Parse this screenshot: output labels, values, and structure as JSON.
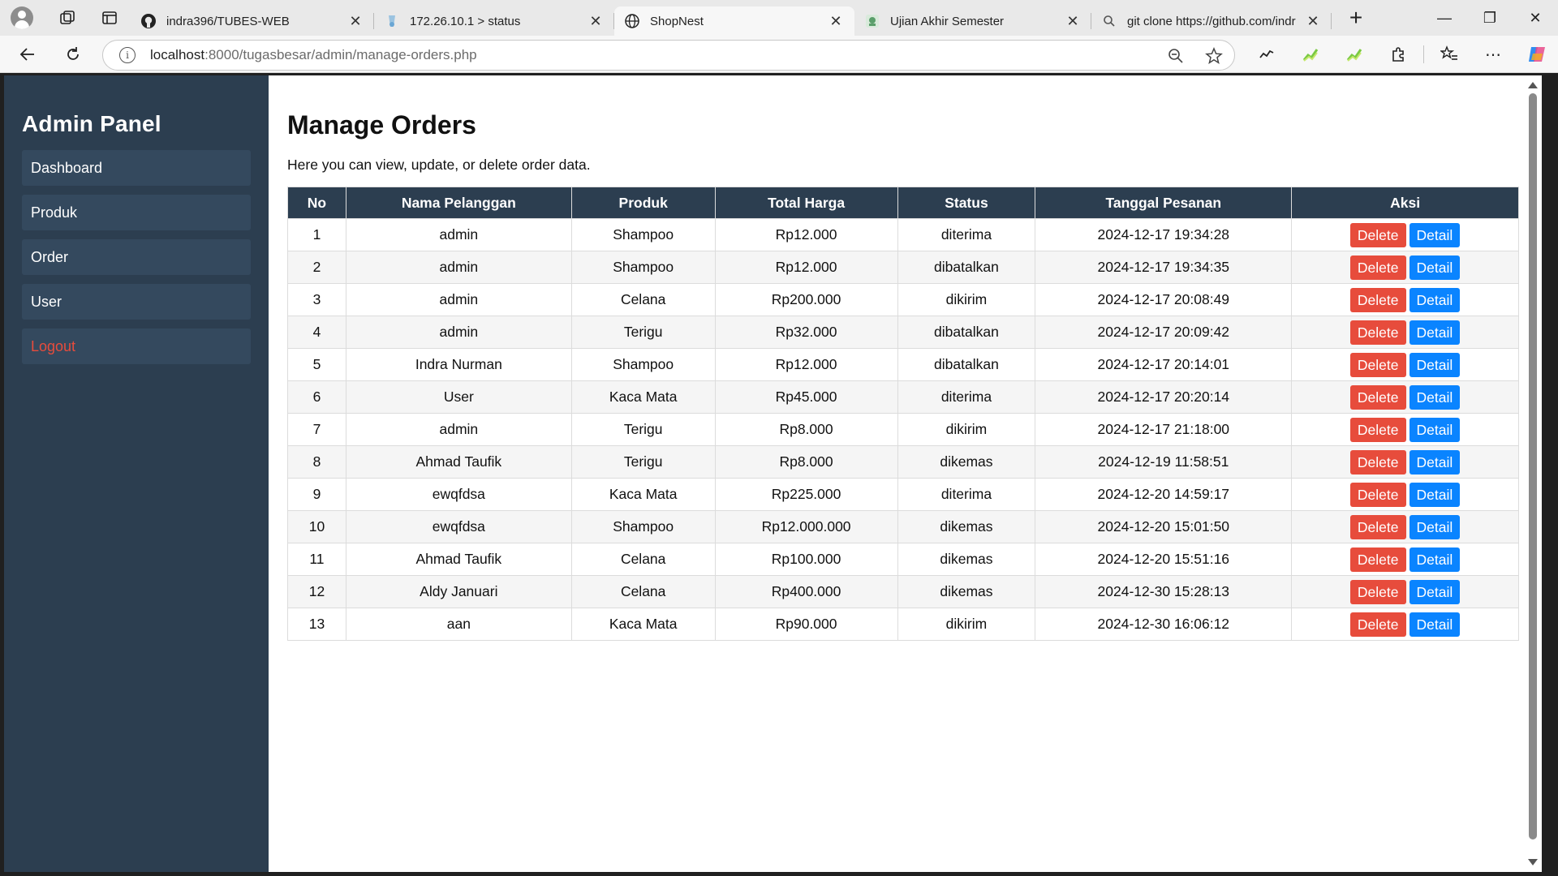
{
  "browser": {
    "tabs": [
      {
        "title": "indra396/TUBES-WEB",
        "icon": "github-icon",
        "active": false
      },
      {
        "title": "172.26.10.1 > status",
        "icon": "router-icon",
        "active": false
      },
      {
        "title": "ShopNest",
        "icon": "globe-icon",
        "active": true
      },
      {
        "title": "Ujian Akhir Semester",
        "icon": "moodle-icon",
        "active": false
      },
      {
        "title": "git clone https://github.com/indr",
        "icon": "search-icon",
        "active": false
      }
    ],
    "new_tab": "+",
    "url_host": "localhost",
    "url_rest": ":8000/tugasbesar/admin/manage-orders.php"
  },
  "sidebar": {
    "title": "Admin Panel",
    "items": [
      {
        "label": "Dashboard"
      },
      {
        "label": "Produk"
      },
      {
        "label": "Order"
      },
      {
        "label": "User"
      },
      {
        "label": "Logout"
      }
    ]
  },
  "main": {
    "title": "Manage Orders",
    "subtitle": "Here you can view, update, or delete order data.",
    "columns": [
      "No",
      "Nama Pelanggan",
      "Produk",
      "Total Harga",
      "Status",
      "Tanggal Pesanan",
      "Aksi"
    ],
    "delete_label": "Delete",
    "detail_label": "Detail",
    "orders": [
      {
        "no": "1",
        "customer": "admin",
        "product": "Shampoo",
        "total": "Rp12.000",
        "status": "diterima",
        "date": "2024-12-17 19:34:28"
      },
      {
        "no": "2",
        "customer": "admin",
        "product": "Shampoo",
        "total": "Rp12.000",
        "status": "dibatalkan",
        "date": "2024-12-17 19:34:35"
      },
      {
        "no": "3",
        "customer": "admin",
        "product": "Celana",
        "total": "Rp200.000",
        "status": "dikirim",
        "date": "2024-12-17 20:08:49"
      },
      {
        "no": "4",
        "customer": "admin",
        "product": "Terigu",
        "total": "Rp32.000",
        "status": "dibatalkan",
        "date": "2024-12-17 20:09:42"
      },
      {
        "no": "5",
        "customer": "Indra Nurman",
        "product": "Shampoo",
        "total": "Rp12.000",
        "status": "dibatalkan",
        "date": "2024-12-17 20:14:01"
      },
      {
        "no": "6",
        "customer": "User",
        "product": "Kaca Mata",
        "total": "Rp45.000",
        "status": "diterima",
        "date": "2024-12-17 20:20:14"
      },
      {
        "no": "7",
        "customer": "admin",
        "product": "Terigu",
        "total": "Rp8.000",
        "status": "dikirim",
        "date": "2024-12-17 21:18:00"
      },
      {
        "no": "8",
        "customer": "Ahmad Taufik",
        "product": "Terigu",
        "total": "Rp8.000",
        "status": "dikemas",
        "date": "2024-12-19 11:58:51"
      },
      {
        "no": "9",
        "customer": "ewqfdsa",
        "product": "Kaca Mata",
        "total": "Rp225.000",
        "status": "diterima",
        "date": "2024-12-20 14:59:17"
      },
      {
        "no": "10",
        "customer": "ewqfdsa",
        "product": "Shampoo",
        "total": "Rp12.000.000",
        "status": "dikemas",
        "date": "2024-12-20 15:01:50"
      },
      {
        "no": "11",
        "customer": "Ahmad Taufik",
        "product": "Celana",
        "total": "Rp100.000",
        "status": "dikemas",
        "date": "2024-12-20 15:51:16"
      },
      {
        "no": "12",
        "customer": "Aldy Januari",
        "product": "Celana",
        "total": "Rp400.000",
        "status": "dikemas",
        "date": "2024-12-30 15:28:13"
      },
      {
        "no": "13",
        "customer": "aan",
        "product": "Kaca Mata",
        "total": "Rp90.000",
        "status": "dikirim",
        "date": "2024-12-30 16:06:12"
      }
    ]
  },
  "colors": {
    "sidebar_bg": "#2c3e50",
    "sidebar_item_bg": "#34495e",
    "logout_text": "#e74c3c",
    "delete_button": "#e74c3c",
    "detail_button": "#0a84ff"
  }
}
